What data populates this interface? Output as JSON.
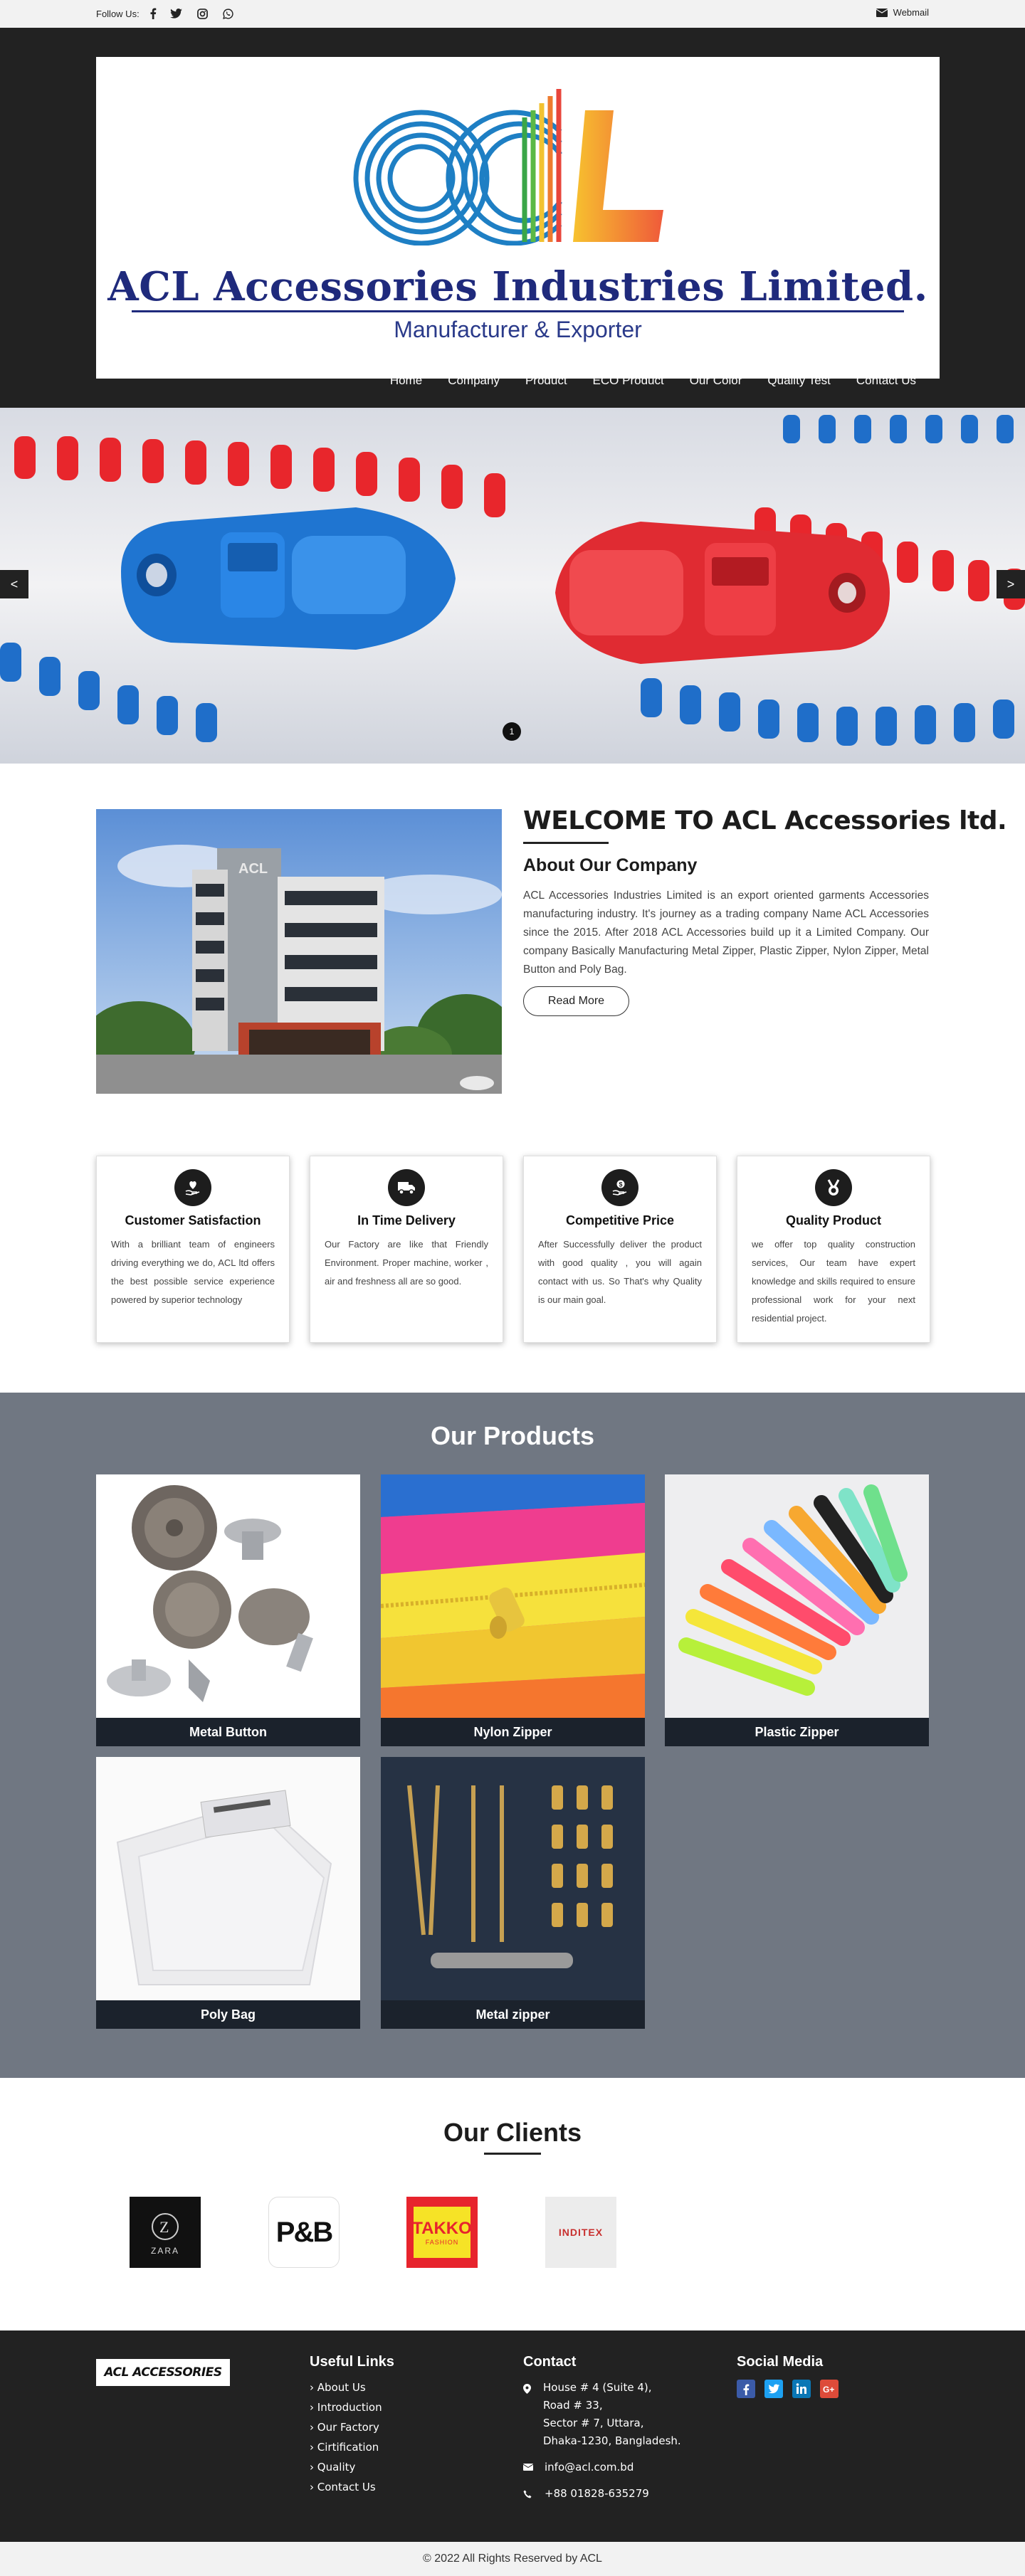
{
  "topbar": {
    "follow_label": "Follow Us:",
    "social_icons": [
      "facebook-icon",
      "twitter-icon",
      "instagram-icon",
      "whatsapp-icon"
    ],
    "webmail_label": "Webmail"
  },
  "header": {
    "logo_title": "ACL Accessories Industries Limited.",
    "logo_subtitle": "Manufacturer & Exporter",
    "nav": [
      "Home",
      "Company",
      "Product",
      "ECO Product",
      "Our Color",
      "Quality Test",
      "Contact Us"
    ]
  },
  "hero": {
    "prev_label": "<",
    "next_label": ">",
    "dot_label": "1"
  },
  "welcome": {
    "title": "WELCOME TO ACL Accessories ltd.",
    "about_title": "About Our Company",
    "about_text": "ACL Accessories Industries Limited is an export oriented garments Accessories manufacturing industry. It's journey as a trading company Name ACL Accessories since the 2015. After 2018 ACL Accessories build up it a Limited Company. Our company Basically Manufacturing Metal Zipper, Plastic Zipper, Nylon Zipper, Metal Button and Poly Bag.",
    "read_more_label": "Read More",
    "building_sign": "ACL"
  },
  "features": [
    {
      "icon": "heart-hand-icon",
      "title": "Customer Satisfaction",
      "text": "With a brilliant team of engineers driving everything we do, ACL ltd offers the best possible service experience powered by superior technology"
    },
    {
      "icon": "truck-icon",
      "title": "In Time Delivery",
      "text": "Our Factory are like that Friendly Environment. Proper machine, worker , air and freshness all are so good."
    },
    {
      "icon": "dollar-hand-icon",
      "title": "Competitive Price",
      "text": "After Successfully deliver the product with good quality , you will again contact with us. So That's why Quality is our main goal."
    },
    {
      "icon": "medal-icon",
      "title": "Quality Product",
      "text": "we offer top quality construction services, Our team have expert knowledge and skills required to ensure professional work for your next residential project."
    }
  ],
  "products": {
    "title": "Our Products",
    "items": [
      "Metal Button",
      "Nylon Zipper",
      "Plastic Zipper",
      "Poly Bag",
      "Metal zipper"
    ]
  },
  "clients": {
    "title": "Our Clients",
    "logos": [
      {
        "name": "zara-logo",
        "text": "ZARA"
      },
      {
        "name": "pb-logo",
        "text": "P&B"
      },
      {
        "name": "takko-logo",
        "text": "TAKKO",
        "sub": "FASHION"
      },
      {
        "name": "inditex-logo",
        "text": "INDITEX"
      }
    ]
  },
  "footer": {
    "logo_text": "ACL ACCESSORIES",
    "useful_title": "Useful Links",
    "useful_links": [
      "About Us",
      "Introduction",
      "Our Factory",
      "Cirtification",
      "Quality",
      "Contact Us"
    ],
    "contact_title": "Contact",
    "address_lines": [
      "House # 4 (Suite 4),",
      "Road # 33,",
      "Sector # 7, Uttara,",
      "Dhaka-1230, Bangladesh."
    ],
    "email": "info@acl.com.bd",
    "phone": "+88 01828-635279",
    "social_title": "Social Media",
    "social_icons": [
      "facebook-icon",
      "twitter-icon",
      "linkedin-icon",
      "google-plus-icon"
    ]
  },
  "copyright": "© 2022 All Rights Reserved by ACL",
  "colors": {
    "dark": "#222222",
    "navy": "#1f2a7c",
    "products_bg": "#707782",
    "label_bg": "#1b222c"
  }
}
